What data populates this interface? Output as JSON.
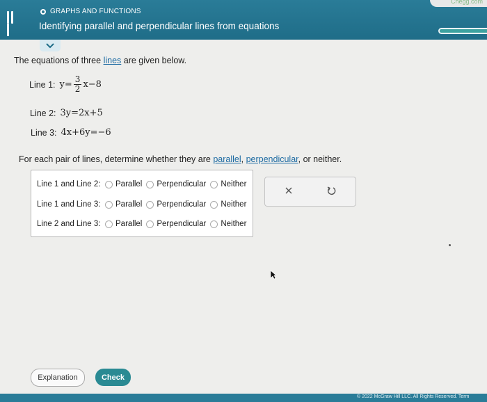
{
  "header": {
    "section_label": "GRAPHS AND FUNCTIONS",
    "topic_title": "Identifying parallel and perpendicular lines from equations",
    "site_badge": "Chegg.com",
    "progress": 1.0
  },
  "intro": {
    "before_link": "The equations of three ",
    "link": "lines",
    "after_link": " are given below."
  },
  "equations": [
    {
      "label": "Line 1:",
      "lhs": "y",
      "eq": "=",
      "num": "3",
      "den": "2",
      "tail": "x−8"
    },
    {
      "label": "Line 2:",
      "math": "3y=2x+5"
    },
    {
      "label": "Line 3:",
      "math": "4x+6y=−6"
    }
  ],
  "prompt": {
    "start": "For each pair of lines, determine whether they are ",
    "link1": "parallel",
    "sep": ", ",
    "link2": "perpendicular",
    "end": ", or neither."
  },
  "rows": [
    {
      "pair": "Line 1 and Line 2:",
      "opt1": "Parallel",
      "opt2": "Perpendicular",
      "opt3": "Neither"
    },
    {
      "pair": "Line 1 and Line 3:",
      "opt1": "Parallel",
      "opt2": "Perpendicular",
      "opt3": "Neither"
    },
    {
      "pair": "Line 2 and Line 3:",
      "opt1": "Parallel",
      "opt2": "Perpendicular",
      "opt3": "Neither"
    }
  ],
  "buttons": {
    "explanation": "Explanation",
    "check": "Check"
  },
  "footer": {
    "copyright": "© 2022 McGraw Hill LLC. All Rights Reserved.   Term"
  },
  "colors": {
    "header": "#1f6d88",
    "accent": "#2a8a93",
    "link": "#1c6aa2"
  }
}
